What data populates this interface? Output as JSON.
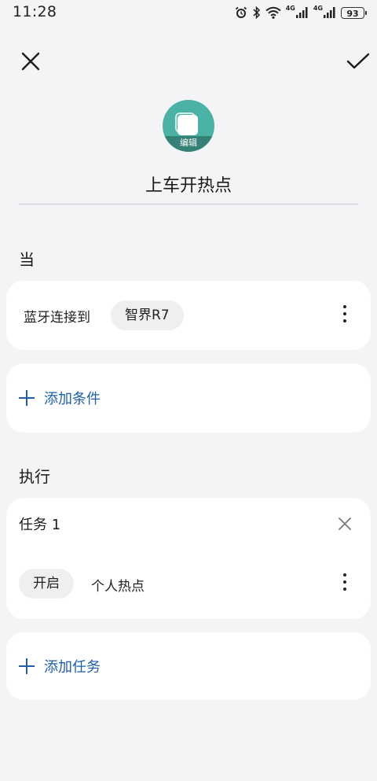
{
  "status_bar": {
    "time": "11:28",
    "net1": "4G",
    "net2": "4G",
    "battery": "93"
  },
  "header": {
    "close_icon": "close-icon",
    "confirm_icon": "check-icon"
  },
  "scene": {
    "icon_color": "#4ab3a6",
    "edit_label": "编辑",
    "name": "上车开热点"
  },
  "when_section": {
    "title": "当",
    "condition": {
      "label": "蓝牙连接到",
      "device": "智界R7"
    },
    "add_condition_label": "添加条件"
  },
  "execute_section": {
    "title": "执行",
    "task": {
      "title": "任务 1",
      "action_state": "开启",
      "action_target": "个人热点"
    },
    "add_task_label": "添加任务"
  },
  "accent_color": "#1f5ea8"
}
